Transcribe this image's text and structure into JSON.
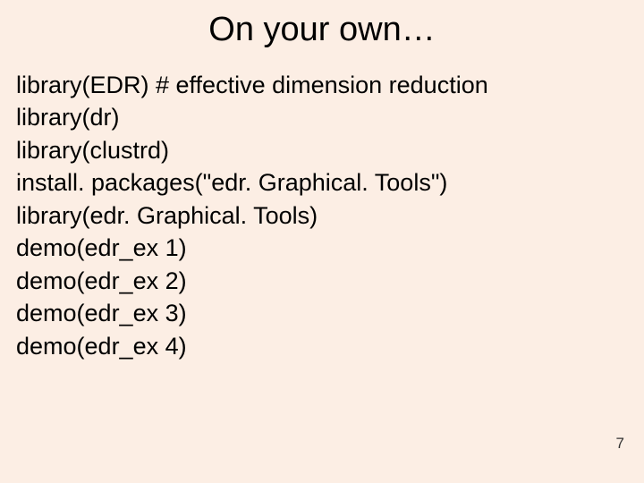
{
  "title": "On your own…",
  "lines": [
    "library(EDR) # effective dimension reduction",
    "library(dr)",
    "library(clustrd)",
    "install. packages(\"edr. Graphical. Tools\")",
    "library(edr. Graphical. Tools)",
    "demo(edr_ex 1)",
    "demo(edr_ex 2)",
    "demo(edr_ex 3)",
    "demo(edr_ex 4)"
  ],
  "page_number": "7"
}
